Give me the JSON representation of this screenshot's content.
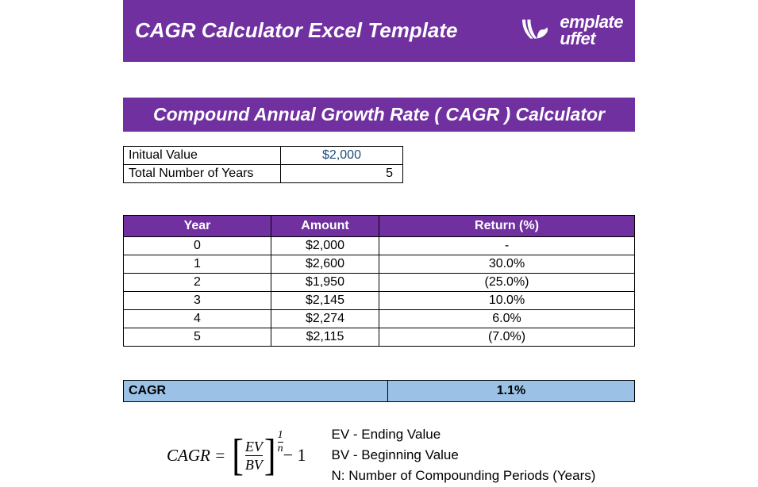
{
  "header": {
    "title": "CAGR Calculator Excel Template",
    "logo": {
      "line1": "emplate",
      "line2": "uffet"
    }
  },
  "subtitle": "Compound Annual Growth Rate ( CAGR ) Calculator",
  "inputs": {
    "initial_label": "Initual Value",
    "initial_value": "$2,000",
    "years_label": "Total Number of Years",
    "years_value": "5"
  },
  "table": {
    "headers": {
      "year": "Year",
      "amount": "Amount",
      "return": "Return (%)"
    },
    "rows": [
      {
        "year": "0",
        "amount": "$2,000",
        "return": "-"
      },
      {
        "year": "1",
        "amount": "$2,600",
        "return": "30.0%"
      },
      {
        "year": "2",
        "amount": "$1,950",
        "return": "(25.0%)"
      },
      {
        "year": "3",
        "amount": "$2,145",
        "return": "10.0%"
      },
      {
        "year": "4",
        "amount": "$2,274",
        "return": "6.0%"
      },
      {
        "year": "5",
        "amount": "$2,115",
        "return": "(7.0%)"
      }
    ]
  },
  "cagr": {
    "label": "CAGR",
    "value": "1.1%"
  },
  "formula": {
    "lhs": "CAGR =",
    "ev": "EV",
    "bv": "BV",
    "exp_num": "1",
    "exp_den": "n",
    "tail": " − 1"
  },
  "legend": {
    "ev": "EV - Ending Value",
    "bv": "BV - Beginning Value",
    "n": "N: Number of Compounding Periods (Years)"
  }
}
